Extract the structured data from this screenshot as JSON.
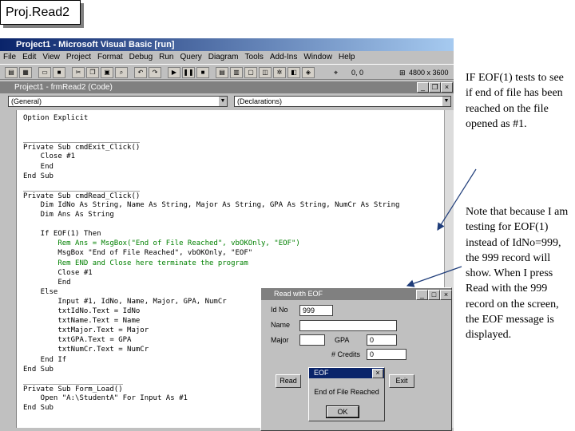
{
  "slide": {
    "title": "Proj.Read2",
    "note1": "IF EOF(1) tests to see if end of file has been reached on the file opened as #1.",
    "note2": "Note that because I am testing for EOF(1) instead of IdNo=999, the 999 record will show. When I press Read with the 999 record on the screen, the EOF message is displayed."
  },
  "ide": {
    "title": "Project1 - Microsoft Visual Basic [run]",
    "menu": [
      "File",
      "Edit",
      "View",
      "Project",
      "Format",
      "Debug",
      "Run",
      "Query",
      "Diagram",
      "Tools",
      "Add-Ins",
      "Window",
      "Help"
    ],
    "coords": "0, 0",
    "size": "4800 x 3600"
  },
  "code_window": {
    "title": "Project1 - frmRead2 (Code)",
    "object_combo": "(General)",
    "proc_combo": "(Declarations)",
    "lines": [
      "Option Explicit",
      "",
      "",
      "Private Sub cmdExit_Click()",
      "    Close #1",
      "    End",
      "End Sub",
      "",
      "Private Sub cmdRead_Click()",
      "    Dim IdNo As String, Name As String, Major As String, GPA As String, NumCr As String",
      "    Dim Ans As String",
      "",
      "    If EOF(1) Then",
      "        Rem Ans = MsgBox(\"End of File Reached\", vbOKOnly, \"EOF\")",
      "        MsgBox \"End of File Reached\", vbOKOnly, \"EOF\"",
      "        Rem END and Close here terminate the program",
      "        Close #1",
      "        End",
      "    Else",
      "        Input #1, IdNo, Name, Major, GPA, NumCr",
      "        txtIdNo.Text = IdNo",
      "        txtName.Text = Name",
      "        txtMajor.Text = Major",
      "        txtGPA.Text = GPA",
      "        txtNumCr.Text = NumCr",
      "    End If",
      "End Sub",
      "",
      "Private Sub Form_Load()",
      "    Open \"A:\\StudentA\" For Input As #1",
      "End Sub"
    ]
  },
  "form": {
    "title": "Read with EOF",
    "labels": {
      "idno": "Id No",
      "name": "Name",
      "major": "Major",
      "gpa": "GPA",
      "credits": "# Credits"
    },
    "values": {
      "idno": "999",
      "name": "",
      "major": "",
      "gpa": "0",
      "credits": "0"
    },
    "read_button": "Read",
    "exit_button": "Exit"
  },
  "msgbox": {
    "title": "EOF",
    "text": "End of File Reached",
    "ok": "OK"
  },
  "colors": {
    "comment": "#008000",
    "arrow": "#1f3d7a",
    "titlebar": "#0a246a"
  }
}
